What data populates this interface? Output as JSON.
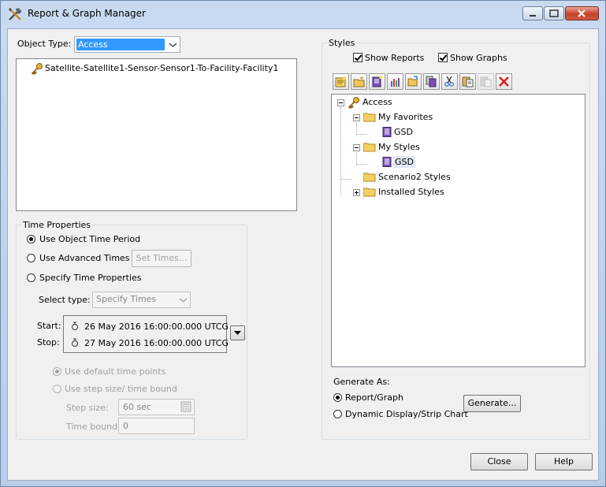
{
  "window": {
    "title": "Report & Graph Manager"
  },
  "object_panel": {
    "type_label": "Object Type:",
    "type_value": "Access",
    "objects": [
      "Satellite-Satellite1-Sensor-Sensor1-To-Facility-Facility1"
    ]
  },
  "time_properties": {
    "title": "Time Properties",
    "use_object_time_period": "Use Object Time Period",
    "use_advanced_times": "Use Advanced Times",
    "set_times_button": "Set Times...",
    "specify_time_properties": "Specify Time Properties",
    "select_type_label": "Select type:",
    "select_type_value": "Specify Times",
    "start_label": "Start:",
    "start_value": "26 May 2016 16:00:00.000 UTCG",
    "stop_label": "Stop:",
    "stop_value": "27 May 2016 16:00:00.000 UTCG",
    "use_default_time_points": "Use default time points",
    "use_step_size": "Use step size/ time bound",
    "step_size_label": "Step size:",
    "step_size_value": "60 sec",
    "time_bound_label": "Time bound:",
    "time_bound_value": "0"
  },
  "styles": {
    "title": "Styles",
    "show_reports": "Show Reports",
    "show_graphs": "Show Graphs",
    "toolbar": [
      "new-report-icon",
      "new-graph-icon",
      "new-report-properties-icon",
      "new-chart-icon",
      "open-folder-icon",
      "copy-style-icon",
      "cut-icon",
      "paste-icon",
      "disabled-paste-icon",
      "delete-icon"
    ],
    "tree": {
      "root": "Access",
      "my_favorites": "My Favorites",
      "fav_gsd": "GSD",
      "my_styles": "My Styles",
      "styles_gsd": "GSD",
      "scenario_styles": "Scenario2 Styles",
      "installed_styles": "Installed Styles"
    }
  },
  "generate": {
    "title": "Generate As:",
    "report_graph": "Report/Graph",
    "dynamic_display": "Dynamic Display/Strip Chart",
    "generate_button": "Generate..."
  },
  "footer": {
    "close_button": "Close",
    "help_button": "Help"
  }
}
